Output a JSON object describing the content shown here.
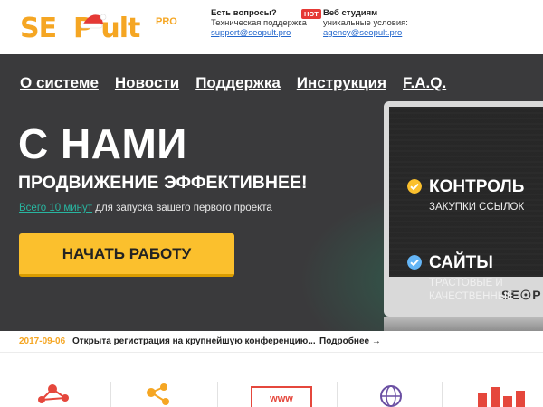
{
  "brand": {
    "logo_text": "SE  P ult",
    "pro_label": "PRO",
    "monitor_brand": "SE☉P"
  },
  "contacts": {
    "support": {
      "title": "Есть вопросы?",
      "subtitle": "Техническая поддержка",
      "email": "support@seopult.pro"
    },
    "hot_badge": "HOT",
    "agency": {
      "title": "Веб студиям",
      "subtitle": "уникальные условия:",
      "email": "agency@seopult.pro"
    }
  },
  "nav": {
    "items": [
      {
        "label": "О системе"
      },
      {
        "label": "Новости"
      },
      {
        "label": "Поддержка"
      },
      {
        "label": "Инструкция"
      },
      {
        "label": "F.A.Q."
      }
    ]
  },
  "hero": {
    "title": "С НАМИ",
    "subtitle": "ПРОДВИЖЕНИЕ ЭФФЕКТИВНЕЕ!",
    "note_highlight": "Всего 10 минут",
    "note_rest": " для запуска вашего первого проекта",
    "cta_label": "НАЧАТЬ РАБОТУ"
  },
  "features": [
    {
      "title": "КОНТРОЛЬ",
      "desc": "ЗАКУПКИ ССЫЛОК"
    },
    {
      "title": "САЙТЫ",
      "desc": "ТРАСТОВЫЕ И КАЧЕСТВЕННЫЕ"
    }
  ],
  "news": {
    "date": "2017-09-06",
    "text": "Открыта регистрация на крупнейшую конференцию...",
    "more": "Подробнее →"
  },
  "bottom_icons": [
    "network-icon",
    "share-icon",
    "www-icon",
    "globe-icon",
    "chart-icon"
  ],
  "colors": {
    "accent": "#f5a623",
    "cta": "#fbc02d",
    "hero_bg": "#3a3a3c",
    "check": "#fbc02d",
    "check_alt": "#64b5f6",
    "link": "#2266cc",
    "teal": "#28b5a0",
    "icon_red": "#e5473c",
    "icon_orange": "#f5a623"
  }
}
